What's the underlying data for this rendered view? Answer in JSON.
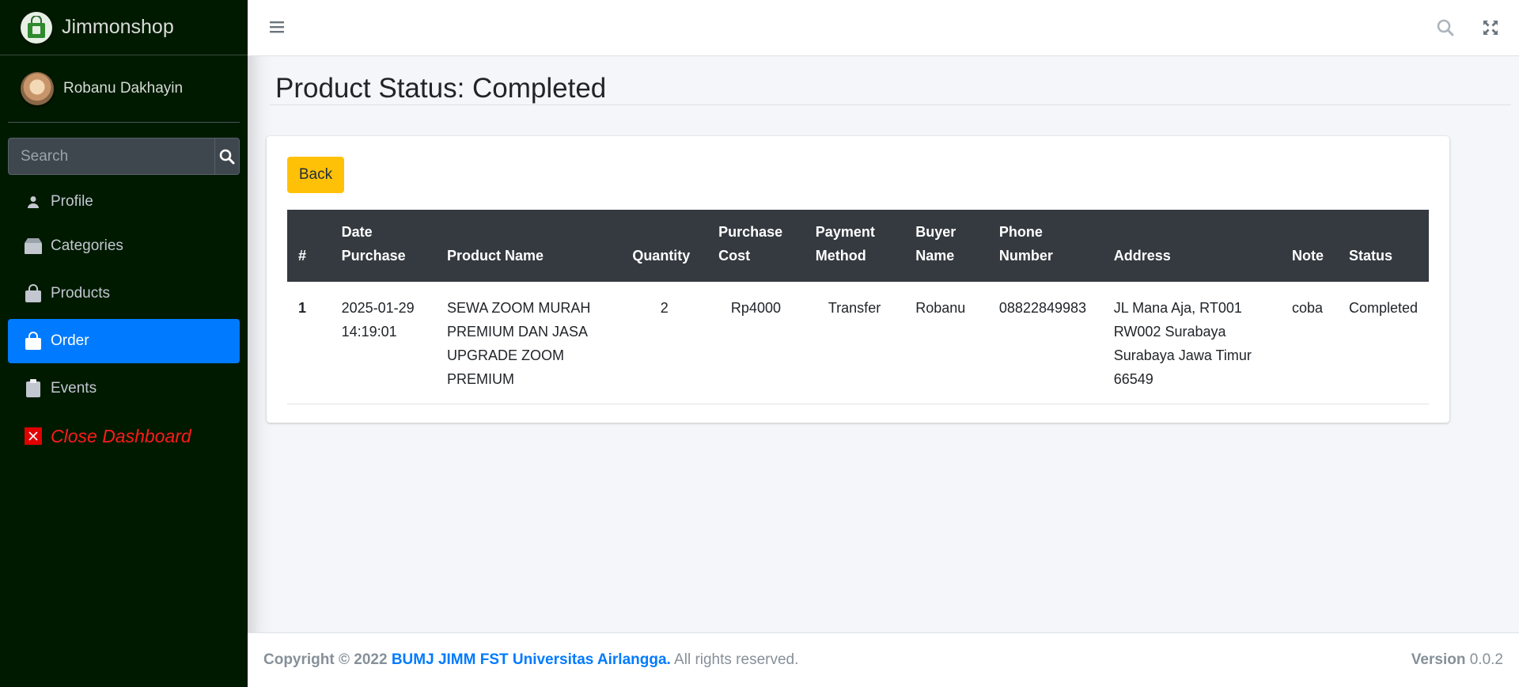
{
  "brand": {
    "name": "Jimmonshop",
    "logo_icon": "shopping-bag-logo-icon"
  },
  "user": {
    "name": "Robanu Dakhayin"
  },
  "sidebar": {
    "search_placeholder": "Search",
    "items": [
      {
        "label": "Profile",
        "icon": "user-icon"
      },
      {
        "label": "Categories",
        "icon": "box-icon"
      },
      {
        "label": "Products",
        "icon": "shopping-bag-icon"
      },
      {
        "label": "Order",
        "icon": "shopping-bag-icon",
        "active": true
      },
      {
        "label": "Events",
        "icon": "clipboard-icon"
      },
      {
        "label": "Close Dashboard",
        "icon": "close-icon"
      }
    ]
  },
  "page": {
    "title": "Product Status: Completed"
  },
  "card": {
    "back_label": "Back",
    "table": {
      "headers": {
        "num": "#",
        "date_1": "Date",
        "date_2": "Purchase",
        "product": "Product Name",
        "quantity": "Quantity",
        "cost_1": "Purchase",
        "cost_2": "Cost",
        "payment_1": "Payment",
        "payment_2": "Method",
        "buyer_1": "Buyer",
        "buyer_2": "Name",
        "phone_1": "Phone",
        "phone_2": "Number",
        "address": "Address",
        "note": "Note",
        "status": "Status"
      },
      "rows": [
        {
          "num": "1",
          "date_1": "2025-01-29",
          "date_2": "14:19:01",
          "product_1": "SEWA ZOOM MURAH",
          "product_2": "PREMIUM DAN JASA",
          "product_3": "UPGRADE ZOOM",
          "product_4": "PREMIUM",
          "quantity": "2",
          "cost": "Rp4000",
          "payment": "Transfer",
          "buyer": "Robanu",
          "phone": "08822849983",
          "address_1": "JL Mana Aja, RT001",
          "address_2": "RW002 Surabaya",
          "address_3": "Surabaya Jawa Timur",
          "address_4": "66549",
          "note": "coba",
          "status": "Completed"
        }
      ]
    }
  },
  "footer": {
    "copyright": "Copyright © 2022",
    "org": "BUMJ JIMM FST Universitas Airlangga.",
    "rights": "All rights reserved.",
    "version_label": "Version",
    "version": "0.0.2"
  },
  "colors": {
    "sidebar_bg": "#001a00",
    "active": "#007bff",
    "back_button": "#ffc107",
    "table_header": "#343a40",
    "close_red": "#ff1a1a"
  }
}
